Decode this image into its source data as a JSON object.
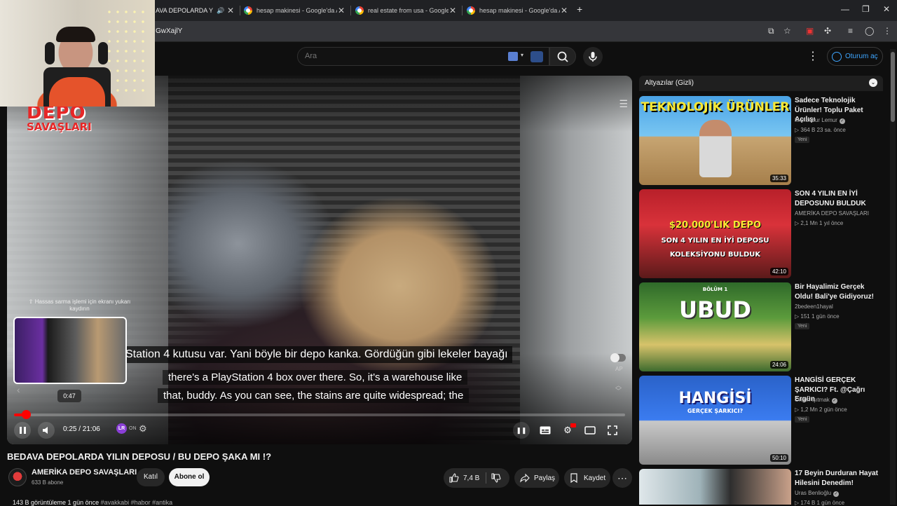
{
  "browser": {
    "tabs": [
      {
        "title": "AVA DEPOLARDA YILIN",
        "active": true
      },
      {
        "title": "hesap makinesi - Google'da Ara"
      },
      {
        "title": "real estate from usa - Google'da Ara"
      },
      {
        "title": "hesap makinesi - Google'da Ara"
      }
    ],
    "new_tab": "+",
    "url": "GwXajlY"
  },
  "header": {
    "search_placeholder": "Ara",
    "signin_label": "Oturum aç"
  },
  "player": {
    "channel_logo": [
      "DEPO",
      "SAVAŞLARI"
    ],
    "subtitle_tr": "Station 4 kutusu var. Yani böyle bir depo kanka. Gördüğün gibi lekeler bayağı",
    "subtitle_en_1": "there's a PlayStation 4 box over there. So, it's a warehouse like",
    "subtitle_en_2": "that, buddy. As you can see, the stains are quite widespread; the",
    "seek_hint": "Hassas sarma işlemi için ekranı yukarı kaydırın",
    "preview_time": "0:47",
    "current_time": "0:25",
    "duration": "21:06",
    "time_display": "0:25 / 21:06",
    "progress_fraction": 0.02,
    "autoplay_label": "AP",
    "lr_badge": "LR",
    "lr_state": "ON"
  },
  "video": {
    "title": "BEDAVA DEPOLARDA YILIN DEPOSU / BU DEPO ŞAKA MI !?",
    "channel": "AMERİKA DEPO SAVAŞLARI",
    "subscribers": "633 B abone",
    "join_label": "Katıl",
    "subscribe_label": "Abone ol",
    "likes": "7,4 B",
    "share_label": "Paylaş",
    "save_label": "Kaydet",
    "meta": "143 B görüntüleme  1 gün önce",
    "tags": "#avakkabi #habor #antika"
  },
  "sidebar": {
    "captions_title": "Altyazılar (Gizli)",
    "recommendations": [
      {
        "title": "Sadece Teknolojik Ürünler! Toplu Paket Açılışı",
        "channel": "Mendebur Lemur",
        "verified": true,
        "stats": "364 B  23 sa. önce",
        "badge": "Yeni",
        "duration": "35:33",
        "thumb_text": "TEKNOLOJİK ÜRÜNLER"
      },
      {
        "title": "SON 4 YILIN EN İYİ DEPOSUNU BULDUK",
        "channel": "AMERİKA DEPO SAVAŞLARI",
        "verified": false,
        "stats": "2,1 Mn  1 yıl önce",
        "badge": "",
        "duration": "42:10",
        "thumb_text": "$20.000'LIK DEPO",
        "thumb_text2": "SON 4 YILIN EN İYİ DEPOSU",
        "thumb_text3": "KOLEKSİYONU BULDUK"
      },
      {
        "title": "Bir Hayalimiz Gerçek Oldu! Bali'ye Gidiyoruz!",
        "channel": "2bedeen1hayal",
        "verified": false,
        "stats": "151  1 gün önce",
        "badge": "Yeni",
        "duration": "24:06",
        "thumb_text": "UBUD",
        "thumb_text2": "BÖLÜM 1"
      },
      {
        "title": "HANGİSİ GERÇEK ŞARKICI? Ft. @Çağrı Ergün",
        "channel": "Orkun Işıtmak",
        "verified": true,
        "stats": "1,2 Mn  2 gün önce",
        "badge": "Yeni",
        "duration": "50:10",
        "thumb_text": "HANGİSİ",
        "thumb_text2": "GERÇEK ŞARKICI?"
      },
      {
        "title": "17 Beyin Durduran Hayat Hilesini Denedim!",
        "channel": "Uras Benlioğlu",
        "verified": true,
        "stats": "174 B  1 gün önce",
        "badge": "",
        "duration": ""
      }
    ]
  },
  "colors": {
    "yt_red": "#ff0000",
    "link_blue": "#3ea6ff",
    "bg": "#0f0f0f"
  }
}
